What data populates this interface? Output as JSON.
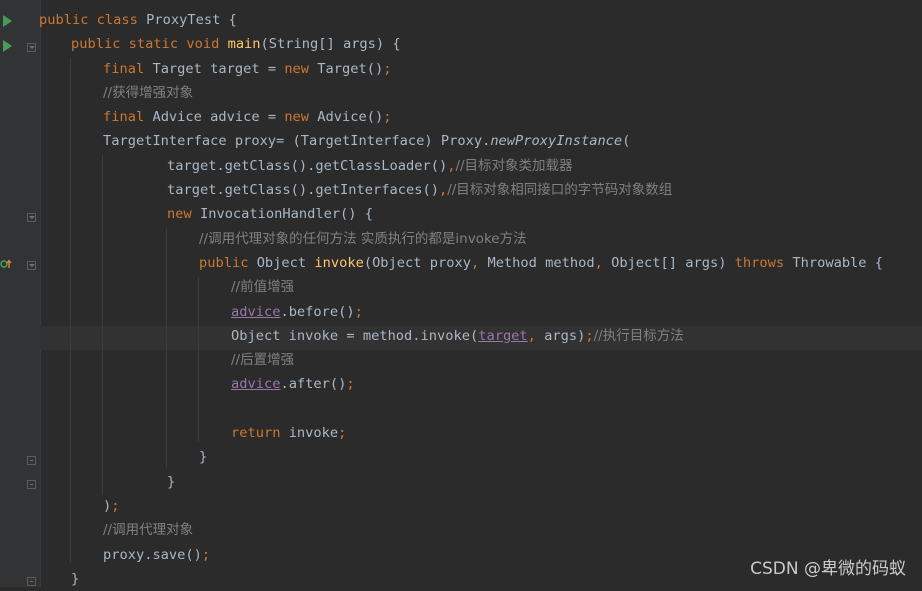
{
  "code_lines": [
    [
      "public class ",
      "ProxyTest {"
    ],
    [
      "public static void ",
      "main",
      "(String[] args) {"
    ],
    [
      "final ",
      "Target target = ",
      "new ",
      "Target()",
      ";"
    ],
    [
      "//获得增强对象"
    ],
    [
      "final ",
      "Advice advice = ",
      "new ",
      "Advice()",
      ";"
    ],
    [
      "TargetInterface proxy= (TargetInterface) Proxy.",
      "newProxyInstance",
      "("
    ],
    [
      "target.getClass().getClassLoader()",
      ",",
      "//目标对象类加载器"
    ],
    [
      "target.getClass().getInterfaces()",
      ",",
      "//目标对象相同接口的字节码对象数组"
    ],
    [
      "new ",
      "InvocationHandler() {"
    ],
    [
      "//调用代理对象的任何方法 实质执行的都是invoke方法"
    ],
    [
      "public ",
      "Object ",
      "invoke",
      "(Object proxy",
      ", ",
      "Method method",
      ", ",
      "Object[] args) ",
      "throws ",
      "Throwable {"
    ],
    [
      "//前值增强"
    ],
    [
      "advice",
      ".before()",
      ";"
    ],
    [
      "Object invoke = method.invoke(",
      "target",
      ", ",
      "args)",
      ";",
      "//执行目标方法"
    ],
    [
      "//后置增强"
    ],
    [
      "advice",
      ".after()",
      ";"
    ],
    [
      ""
    ],
    [
      "return ",
      "invoke",
      ";"
    ],
    [
      "}"
    ],
    [
      "}"
    ],
    [
      ")",
      ";"
    ],
    [
      "//调用代理对象"
    ],
    [
      "proxy.save()",
      ";"
    ],
    [
      "}"
    ]
  ],
  "watermark": "CSDN @卑微的码蚁",
  "icons": {
    "run_gutter": "run-triangle-icon",
    "fold_marker": "fold-marker-icon",
    "implements_marker": "implements-marker-icon"
  },
  "colors": {
    "background": "#2b2b2b",
    "keyword": "#cc7832",
    "method_decl": "#ffc66d",
    "comment": "#808080",
    "field": "#9876aa",
    "text": "#a9b7c6",
    "run_icon": "#499c54"
  }
}
